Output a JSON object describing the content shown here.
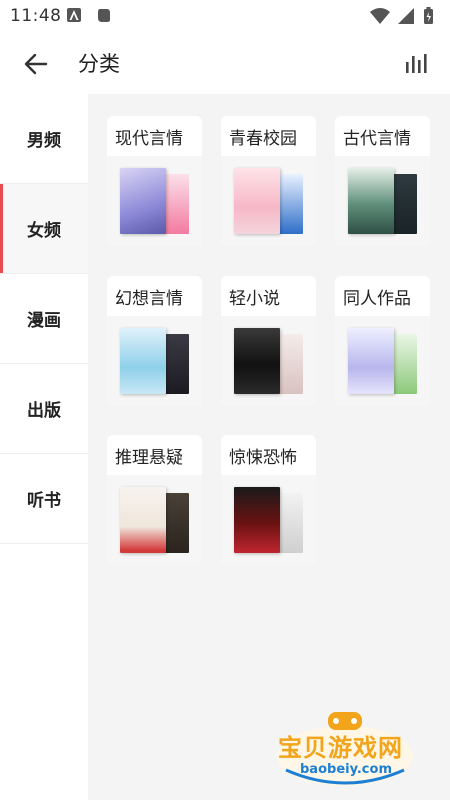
{
  "status_bar": {
    "time": "11:48"
  },
  "app_bar": {
    "title": "分类"
  },
  "sidebar": {
    "items": [
      {
        "label": "男频"
      },
      {
        "label": "女频"
      },
      {
        "label": "漫画"
      },
      {
        "label": "出版"
      },
      {
        "label": "听书"
      }
    ],
    "active_index": 1
  },
  "categories": [
    {
      "title": "现代言情"
    },
    {
      "title": "青春校园"
    },
    {
      "title": "古代言情"
    },
    {
      "title": "幻想言情"
    },
    {
      "title": "轻小说"
    },
    {
      "title": "同人作品"
    },
    {
      "title": "推理悬疑"
    },
    {
      "title": "惊悚恐怖"
    }
  ],
  "watermark": {
    "text": "宝贝游戏网",
    "url": "baobeiy.com"
  },
  "colors": {
    "accent": "#e84c4c",
    "content_bg": "#f4f4f4"
  }
}
